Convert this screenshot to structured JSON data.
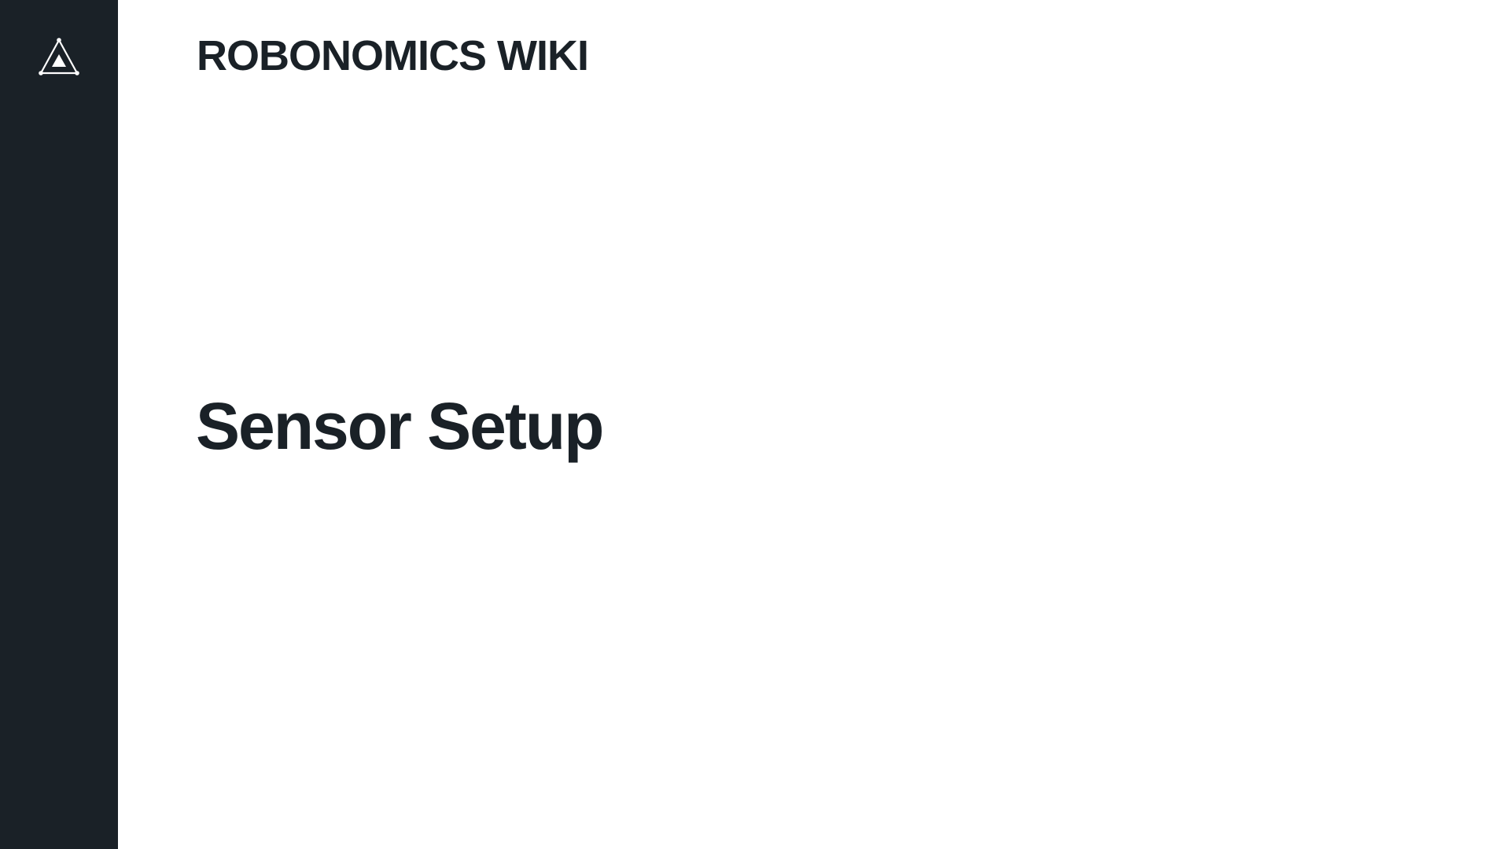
{
  "sidebar": {
    "logo_icon": "robonomics-triangle-logo-icon",
    "background_color": "#1a2127"
  },
  "header": {
    "site_title": "ROBONOMICS WIKI"
  },
  "main": {
    "page_title": "Sensor Setup"
  },
  "colors": {
    "text": "#1a2127",
    "background": "#ffffff"
  }
}
